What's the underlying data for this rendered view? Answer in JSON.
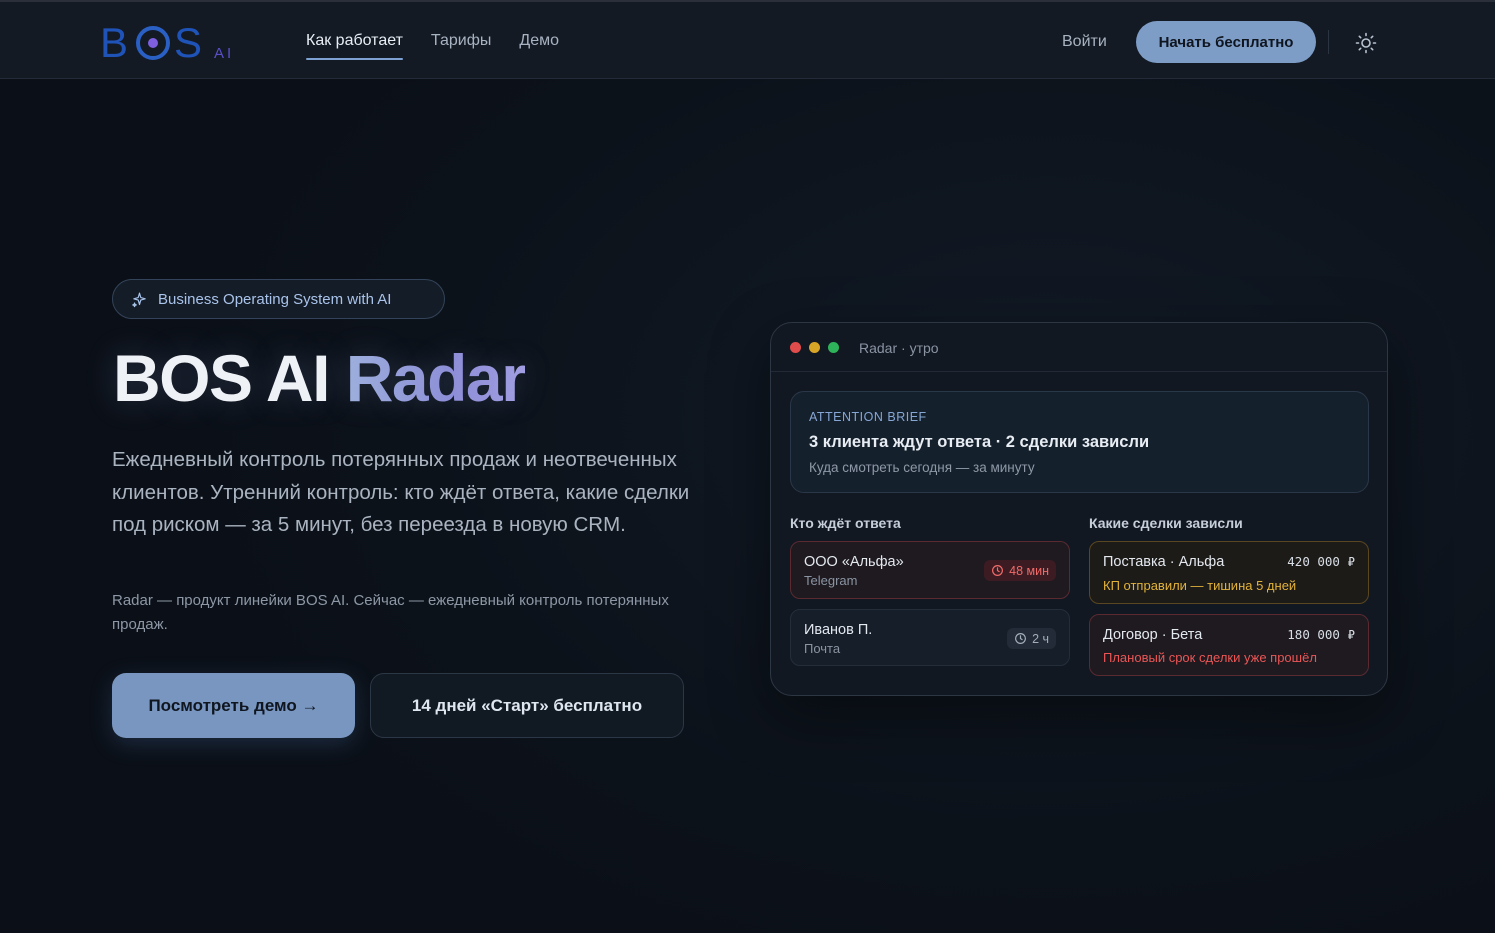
{
  "header": {
    "logo_main": "B",
    "logo_end": "S",
    "logo_ai": "AI",
    "nav": [
      {
        "label": "Как работает",
        "active": true
      },
      {
        "label": "Тарифы",
        "active": false
      },
      {
        "label": "Демо",
        "active": false
      }
    ],
    "login": "Войти",
    "cta": "Начать бесплатно",
    "theme_icon": "sun-icon"
  },
  "hero": {
    "pill": "Business Operating System with AI",
    "pill_icon": "sparkle-icon",
    "title_main": "BOS AI ",
    "title_accent": "Radar",
    "lead": "Ежедневный контроль потерянных продаж и неотвеченных клиентов. Утренний контроль: кто ждёт ответа, какие сделки под риском — за 5 минут, без переезда в новую CRM.",
    "sub": "Radar — продукт линейки BOS AI. Сейчас — ежедневный контроль потерянных продаж.",
    "btn_primary": "Посмотреть демо →",
    "btn_secondary": "14 дней «Старт» бесплатно"
  },
  "radar": {
    "window_title": "Radar · утро",
    "brief_kicker": "ATTENTION BRIEF",
    "brief_head": "3 клиента ждут ответа · 2 сделки зависли",
    "brief_sub": "Куда смотреть сегодня — за минуту",
    "waiting_title": "Кто ждёт ответа",
    "stuck_title": "Какие сделки зависли",
    "waiting": [
      {
        "name": "ООО «Альфа»",
        "channel": "Telegram",
        "time": "48 мин",
        "urgent": true
      },
      {
        "name": "Иванов П.",
        "channel": "Почта",
        "time": "2 ч",
        "urgent": false
      }
    ],
    "stuck": [
      {
        "name": "Поставка · Альфа",
        "amount": "420 000 ₽",
        "note": "КП отправили — тишина 5 дней",
        "level": "warning"
      },
      {
        "name": "Договор · Бета",
        "amount": "180 000 ₽",
        "note": "Плановый срок сделки уже прошёл",
        "level": "danger"
      }
    ]
  },
  "colors": {
    "background": "#0d131c",
    "accent": "#7d9cc6",
    "warning": "#e2b23a",
    "danger": "#e04c4c",
    "dot_red": "#e04c4c",
    "dot_yellow": "#d8a526",
    "dot_green": "#2fb35a"
  }
}
